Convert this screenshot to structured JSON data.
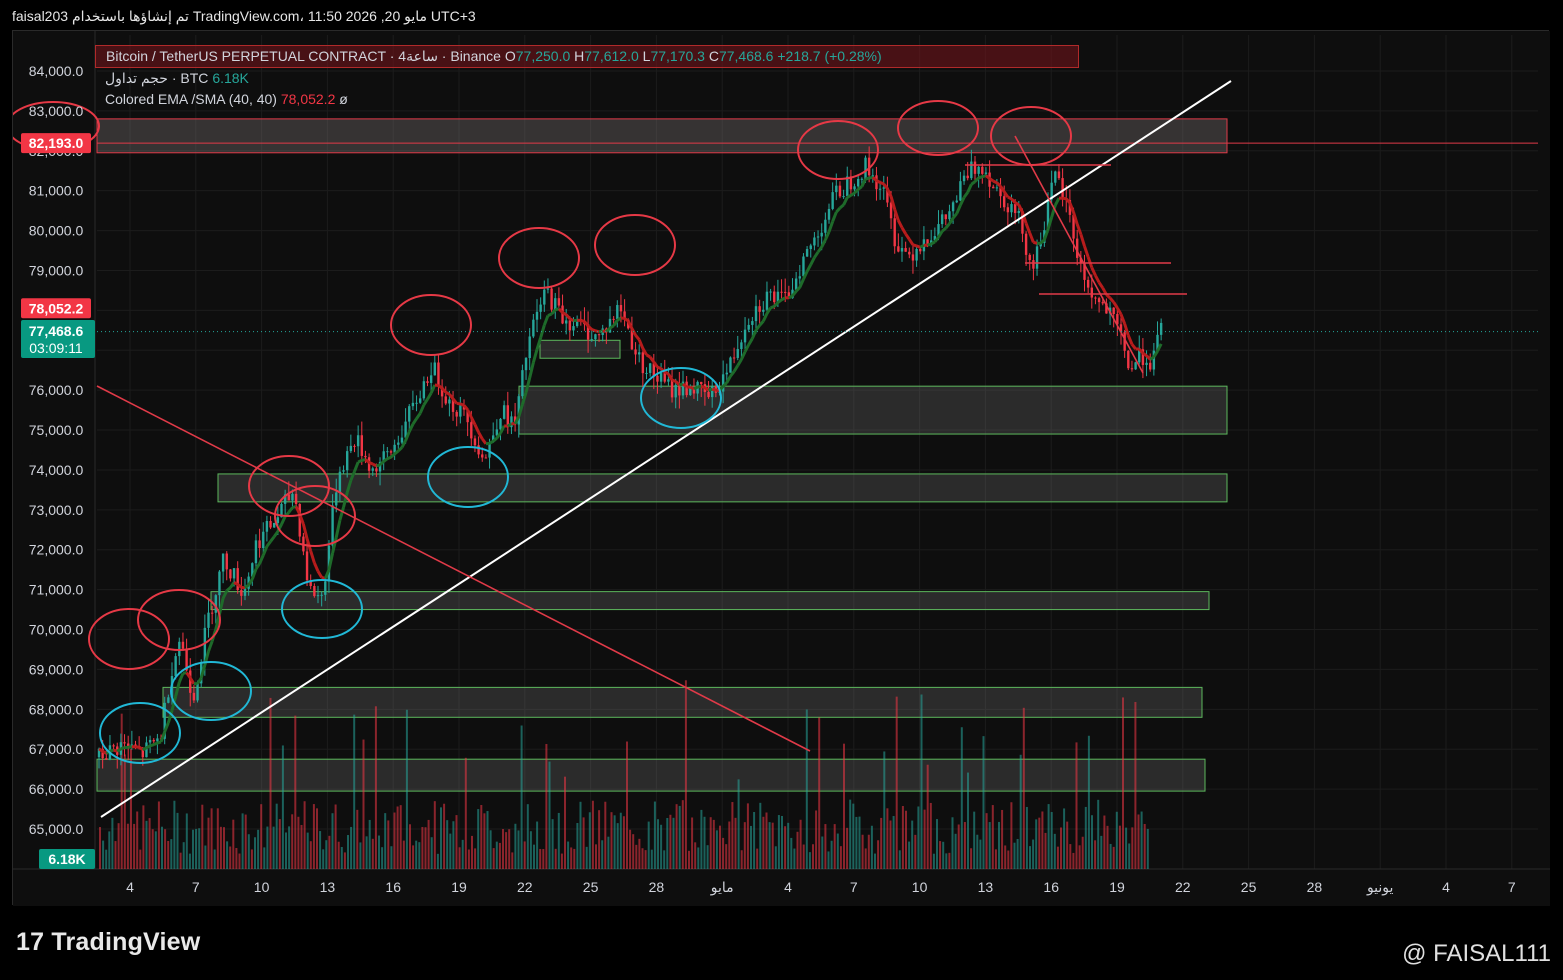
{
  "header": {
    "caption": "faisal203 تم إنشاؤها باستخدام TradingView.com، 11:50 2026 ,20 مايو UTC+3"
  },
  "legend": {
    "symbol": "Bitcoin / TetherUS PERPETUAL CONTRACT · 4ساعة · Binance",
    "o_label": "O",
    "o_value": "77,250.0",
    "h_label": "H",
    "h_value": "77,612.0",
    "l_label": "L",
    "l_value": "77,170.3",
    "c_label": "C",
    "c_value": "77,468.6",
    "change": "+218.7 (+0.28%)",
    "volume_label": "حجم تداول · BTC",
    "volume_value": "6.18K",
    "indicator_label": "Colored EMA /SMA (40, 40)",
    "indicator_value": "78,052.2",
    "indicator_symbol": "ø"
  },
  "footer": {
    "brand_logo": "17",
    "brand_name": "TradingView",
    "handle": "@ FAISAL111"
  },
  "colors": {
    "background": "#0e0e0e",
    "grid": "#1c1c1c",
    "up": "#26a69a",
    "down": "#f23645",
    "ema_green": "#1e6b2a",
    "ema_red": "#b71c1c",
    "trendline": "#ffffff",
    "resistance_line": "#e03a48",
    "support_zone_border": "#5cb85c",
    "marker_red": "#e63946",
    "marker_blue": "#21b8d6"
  },
  "chart_data": {
    "type": "candlestick",
    "price_axis_labels": [
      "84,000.0",
      "83,000.0",
      "82,000.0",
      "81,000.0",
      "80,000.0",
      "79,000.0",
      "78,000.0",
      "77,000.0",
      "76,000.0",
      "75,000.0",
      "74,000.0",
      "73,000.0",
      "72,000.0",
      "71,000.0",
      "70,000.0",
      "69,000.0",
      "68,000.0",
      "67,000.0",
      "66,000.0",
      "65,000.0"
    ],
    "ylim": [
      64000,
      84800
    ],
    "time_axis_labels": [
      "4",
      "7",
      "10",
      "13",
      "16",
      "19",
      "22",
      "25",
      "28",
      "مايو",
      "4",
      "7",
      "10",
      "13",
      "16",
      "19",
      "22",
      "25",
      "28",
      "يونيو",
      "4",
      "7"
    ],
    "badges": {
      "resistance": "82,193.0",
      "ema": "78,052.2",
      "last_price": "77,468.6",
      "countdown": "03:09:11",
      "volume": "6.18K"
    },
    "resistance_level": 82193.0,
    "last_price": 77468.6,
    "ema_value": 78052.2,
    "daily_closes": [
      {
        "t": 0,
        "v": 66800
      },
      {
        "t": 1,
        "v": 67100
      },
      {
        "t": 2,
        "v": 66900
      },
      {
        "t": 2.8,
        "v": 67300
      },
      {
        "t": 3.3,
        "v": 69000
      },
      {
        "t": 3.7,
        "v": 69800
      },
      {
        "t": 4.3,
        "v": 68300
      },
      {
        "t": 5,
        "v": 70300
      },
      {
        "t": 5.7,
        "v": 71800
      },
      {
        "t": 6.6,
        "v": 70900
      },
      {
        "t": 7.2,
        "v": 72200
      },
      {
        "t": 8.0,
        "v": 72700
      },
      {
        "t": 8.9,
        "v": 73500
      },
      {
        "t": 9.6,
        "v": 71000
      },
      {
        "t": 10.2,
        "v": 70800
      },
      {
        "t": 10.9,
        "v": 73900
      },
      {
        "t": 11.7,
        "v": 74800
      },
      {
        "t": 12.5,
        "v": 74000
      },
      {
        "t": 13.3,
        "v": 74400
      },
      {
        "t": 14.3,
        "v": 75500
      },
      {
        "t": 15.2,
        "v": 76600
      },
      {
        "t": 16.0,
        "v": 75700
      },
      {
        "t": 16.8,
        "v": 75300
      },
      {
        "t": 17.6,
        "v": 74200
      },
      {
        "t": 18.3,
        "v": 75500
      },
      {
        "t": 19.0,
        "v": 75100
      },
      {
        "t": 19.6,
        "v": 77200
      },
      {
        "t": 20.4,
        "v": 78500
      },
      {
        "t": 21.2,
        "v": 77800
      },
      {
        "t": 22.0,
        "v": 77600
      },
      {
        "t": 22.8,
        "v": 77300
      },
      {
        "t": 23.8,
        "v": 78100
      },
      {
        "t": 24.6,
        "v": 76800
      },
      {
        "t": 25.3,
        "v": 76400
      },
      {
        "t": 26.2,
        "v": 76000
      },
      {
        "t": 27.0,
        "v": 76100
      },
      {
        "t": 27.9,
        "v": 75800
      },
      {
        "t": 28.8,
        "v": 76600
      },
      {
        "t": 29.6,
        "v": 77800
      },
      {
        "t": 30.6,
        "v": 78400
      },
      {
        "t": 31.3,
        "v": 78200
      },
      {
        "t": 32.0,
        "v": 79100
      },
      {
        "t": 32.8,
        "v": 79900
      },
      {
        "t": 33.5,
        "v": 80800
      },
      {
        "t": 34.2,
        "v": 81200
      },
      {
        "t": 35.0,
        "v": 81600
      },
      {
        "t": 35.8,
        "v": 81000
      },
      {
        "t": 36.4,
        "v": 79700
      },
      {
        "t": 37.0,
        "v": 79400
      },
      {
        "t": 37.7,
        "v": 79800
      },
      {
        "t": 38.4,
        "v": 80100
      },
      {
        "t": 39.0,
        "v": 80600
      },
      {
        "t": 39.6,
        "v": 81400
      },
      {
        "t": 40.3,
        "v": 81700
      },
      {
        "t": 40.9,
        "v": 81100
      },
      {
        "t": 41.5,
        "v": 80700
      },
      {
        "t": 42.1,
        "v": 80200
      },
      {
        "t": 42.6,
        "v": 79000
      },
      {
        "t": 43.2,
        "v": 80300
      },
      {
        "t": 43.7,
        "v": 81400
      },
      {
        "t": 44.3,
        "v": 80400
      },
      {
        "t": 44.8,
        "v": 79100
      },
      {
        "t": 45.4,
        "v": 78300
      },
      {
        "t": 46.0,
        "v": 78000
      },
      {
        "t": 46.6,
        "v": 77400
      },
      {
        "t": 47.1,
        "v": 76500
      },
      {
        "t": 47.6,
        "v": 76900
      },
      {
        "t": 48.1,
        "v": 76700
      },
      {
        "t": 48.5,
        "v": 77468.6
      }
    ],
    "resistance_zones": [
      {
        "from": 81950,
        "to": 82800
      }
    ],
    "support_zones": [
      {
        "from": 74900,
        "to": 76100
      },
      {
        "from": 73200,
        "to": 73900
      },
      {
        "from": 70500,
        "to": 70950
      },
      {
        "from": 67800,
        "to": 68550
      },
      {
        "from": 65950,
        "to": 66750
      },
      {
        "from": 76800,
        "to": 77250
      }
    ]
  }
}
